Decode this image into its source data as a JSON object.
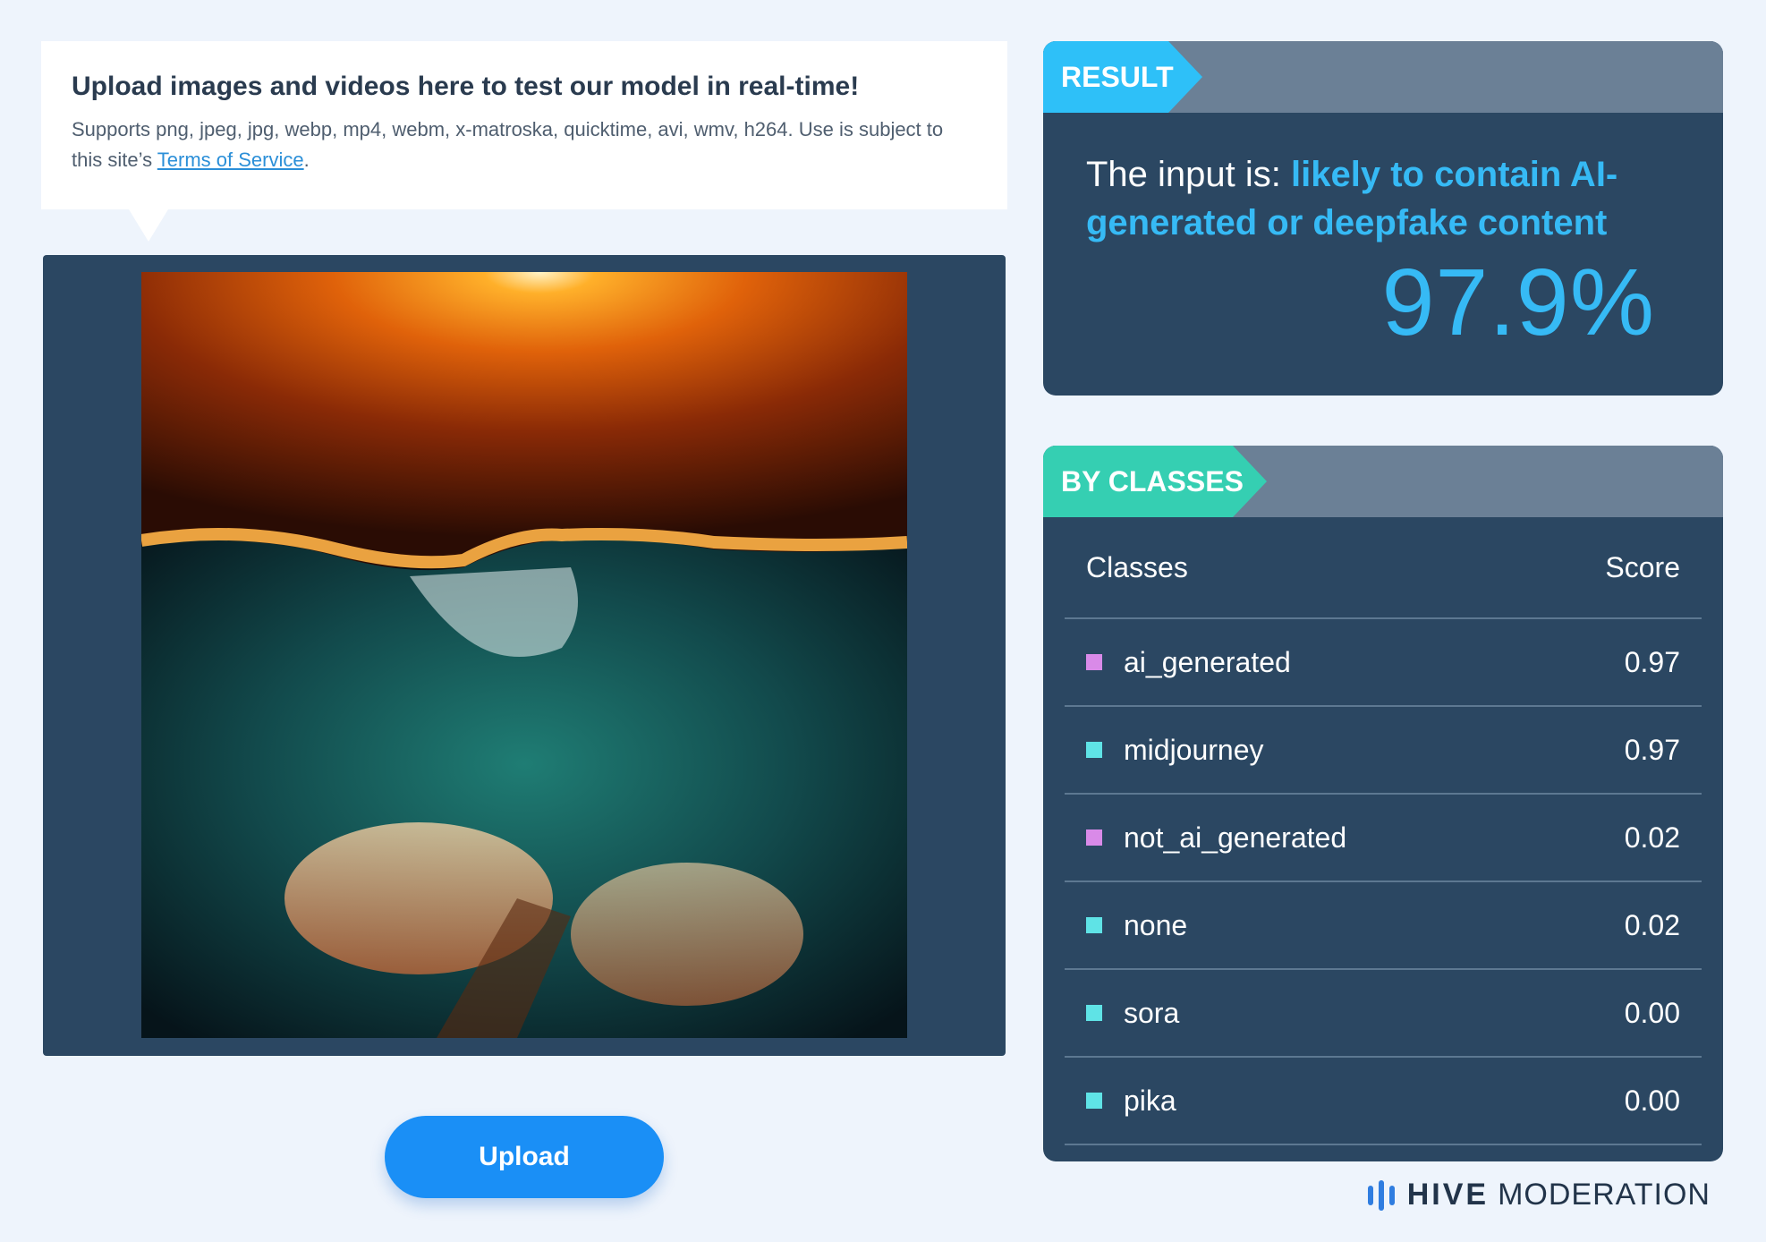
{
  "info": {
    "title": "Upload images and videos here to test our model in real-time!",
    "subtitle_prefix": "Supports png, jpeg, jpg, webp, mp4, webm, x-matroska, quicktime, avi, wmv, h264. Use is subject to this site’s",
    "tos_link": "Terms of Service",
    "subtitle_suffix": "."
  },
  "upload": {
    "label": "Upload"
  },
  "result": {
    "tag": "RESULT",
    "prefix": "The input is: ",
    "verdict": "likely to contain AI-generated or deepfake content",
    "score": "97.9%"
  },
  "classes": {
    "tag": "BY CLASSES",
    "header": {
      "class": "Classes",
      "score": "Score"
    },
    "rows": [
      {
        "name": "ai_generated",
        "score": "0.97",
        "color": "#d98ae8"
      },
      {
        "name": "midjourney",
        "score": "0.97",
        "color": "#5fe3e6"
      },
      {
        "name": "not_ai_generated",
        "score": "0.02",
        "color": "#d98ae8"
      },
      {
        "name": "none",
        "score": "0.02",
        "color": "#5fe3e6"
      },
      {
        "name": "sora",
        "score": "0.00",
        "color": "#5fe3e6"
      },
      {
        "name": "pika",
        "score": "0.00",
        "color": "#5fe3e6"
      }
    ]
  },
  "brand": {
    "hive": "HIVE",
    "moderation": "MODERATION",
    "logo_icon": "hive-bars-icon"
  },
  "colors": {
    "accent": "#36baf5",
    "panel": "#2b4762",
    "button": "#1a8ff6",
    "result_tag": "#2ec0f8",
    "classes_tag": "#35cfb2"
  }
}
